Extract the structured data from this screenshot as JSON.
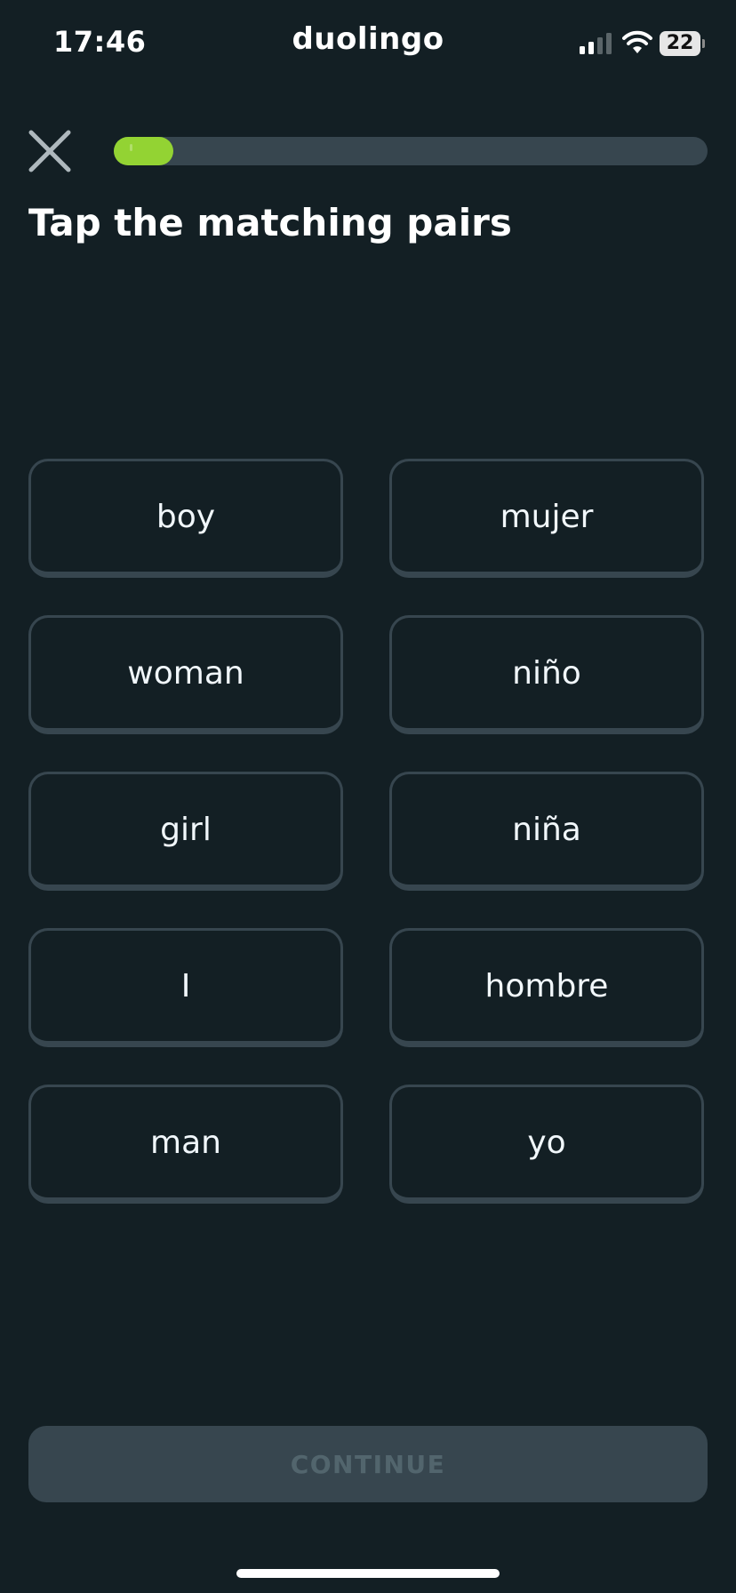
{
  "status_bar": {
    "time": "17:46",
    "app_name": "duolingo",
    "battery_level": "22",
    "icons": [
      "signal-icon",
      "wifi-icon",
      "battery-icon"
    ]
  },
  "header": {
    "close_icon": "close-icon",
    "progress_fraction": 0.1
  },
  "title": "Tap the matching pairs",
  "pairs": {
    "left": [
      "boy",
      "woman",
      "girl",
      "I",
      "man"
    ],
    "right": [
      "mujer",
      "niño",
      "niña",
      "hombre",
      "yo"
    ]
  },
  "continue_label": "CONTINUE",
  "colors": {
    "background": "#131f24",
    "accent": "#93d333",
    "tile_border": "#37464f",
    "button_disabled": "#37464f",
    "button_disabled_text": "#52656d"
  }
}
